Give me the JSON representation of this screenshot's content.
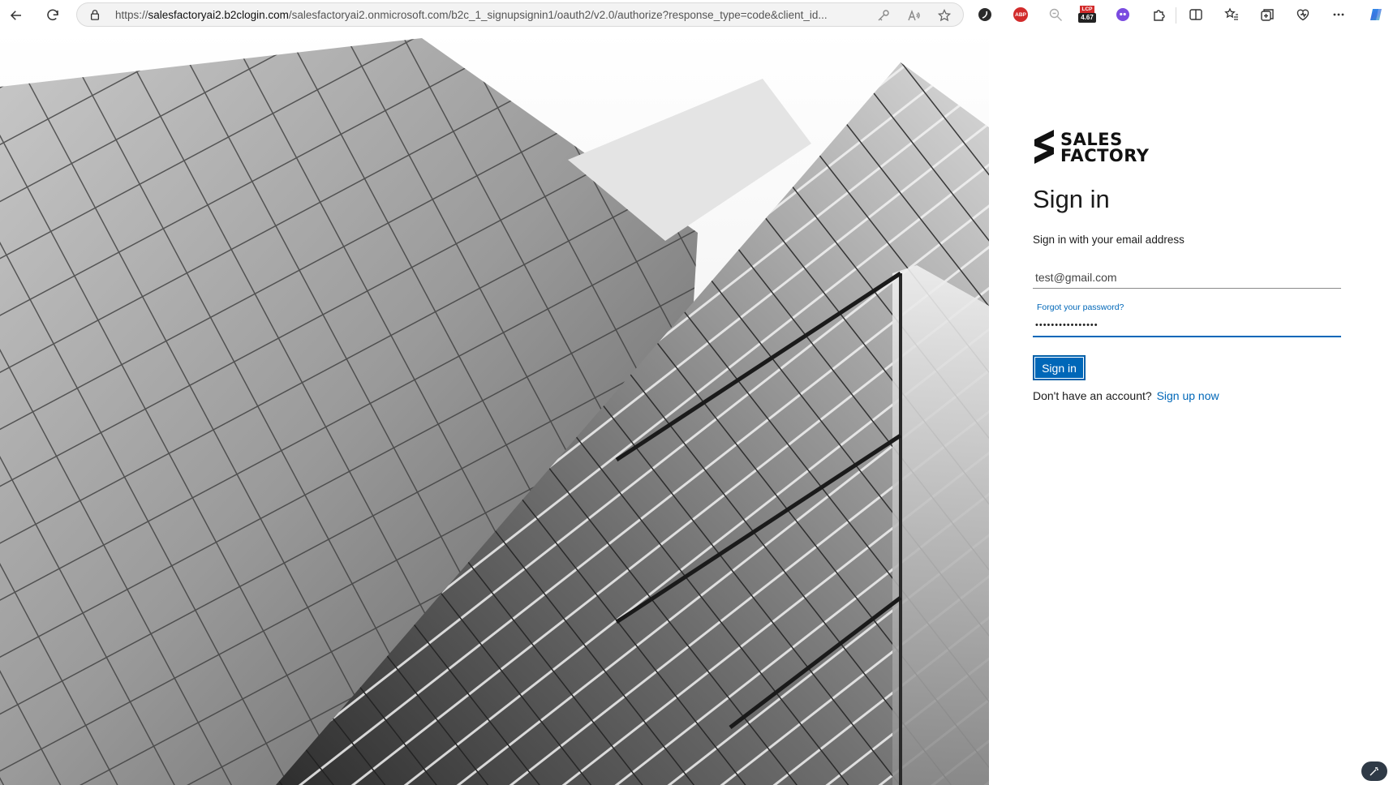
{
  "browser": {
    "url_prefix": "https://",
    "url_host": "salesfactoryai2.b2clogin.com",
    "url_rest": "/salesfactoryai2.onmicrosoft.com/b2c_1_signupsignin1/oauth2/v2.0/authorize?response_type=code&client_id...",
    "extensions": {
      "abp_label": "ABP",
      "lcp_label": "LCP",
      "lcp_value": "4.67"
    }
  },
  "logo": {
    "line1": "SALES",
    "line2": "FACTORY"
  },
  "signin": {
    "title": "Sign in",
    "intro": "Sign in with your email address",
    "email_value": "test@gmail.com",
    "forgot_label": "Forgot your password?",
    "password_value": "••••••••••••••••",
    "button_label": "Sign in",
    "no_account_text": "Don't have an account?",
    "signup_label": "Sign up now"
  },
  "colors": {
    "accent": "#0067b8"
  }
}
